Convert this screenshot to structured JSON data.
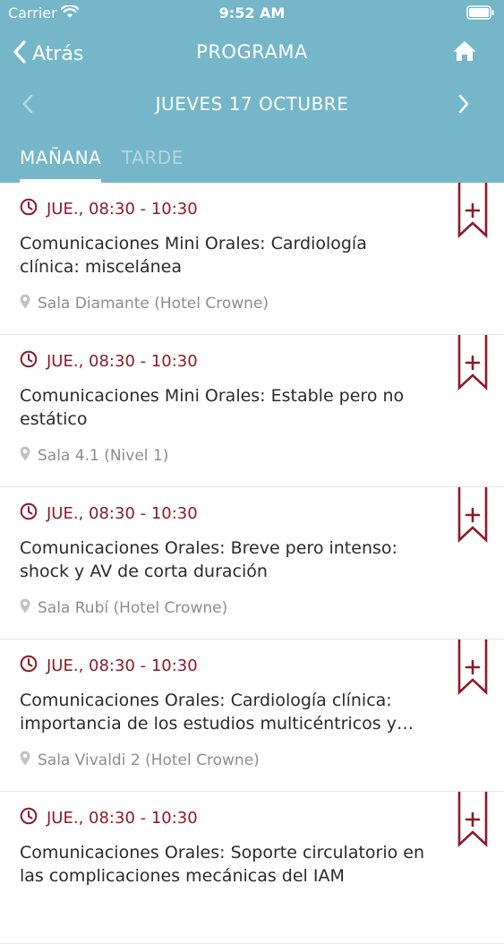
{
  "status_bar": {
    "carrier": "Carrier",
    "time": "9:52 AM",
    "wifi_icon": "wifi-icon",
    "battery_icon": "battery-icon"
  },
  "nav": {
    "back_label": "Atrás",
    "title": "PROGRAMA",
    "home_icon": "home-icon"
  },
  "date_selector": {
    "label": "JUEVES 17 OCTUBRE",
    "prev_icon": "chevron-left-icon",
    "next_icon": "chevron-right-icon"
  },
  "tabs": [
    {
      "label": "MAÑANA",
      "active": true
    },
    {
      "label": "TARDE",
      "active": false
    }
  ],
  "colors": {
    "header_bg": "#75b6c8",
    "accent": "#8b1a2b",
    "room_text": "#8c8c8c"
  },
  "sessions": [
    {
      "time": "JUE., 08:30 - 10:30",
      "title": "Comunicaciones Mini Orales: Cardiología clínica: miscelánea",
      "room": "Sala Diamante (Hotel Crowne)"
    },
    {
      "time": "JUE., 08:30 - 10:30",
      "title": "Comunicaciones Mini Orales: Estable pero no estático",
      "room": "Sala 4.1 (Nivel 1)"
    },
    {
      "time": "JUE., 08:30 - 10:30",
      "title": "Comunicaciones Orales: Breve pero intenso: shock y AV de corta duración",
      "room": "Sala Rubí (Hotel Crowne)"
    },
    {
      "time": "JUE., 08:30 - 10:30",
      "title": "Comunicaciones Orales: Cardiología clínica: importancia de los estudios multicéntricos y…",
      "room": "Sala Vivaldi 2 (Hotel Crowne)"
    },
    {
      "time": "JUE., 08:30 - 10:30",
      "title": "Comunicaciones Orales: Soporte circulatorio en las complicaciones mecánicas del IAM",
      "room": ""
    }
  ]
}
